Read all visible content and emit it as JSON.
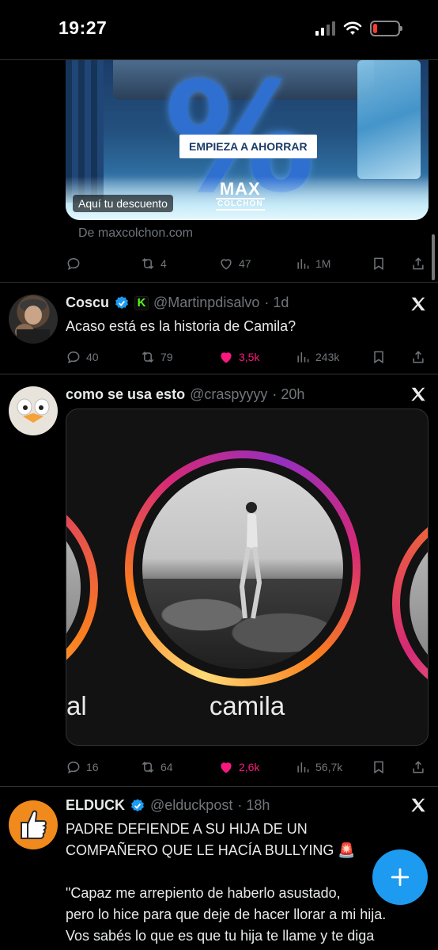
{
  "status": {
    "time": "19:27",
    "battery_level": 0.18
  },
  "ad": {
    "cta_label": "EMPIEZA A AHORRAR",
    "badge": "Aquí tu descuento",
    "logo_main": "MAX",
    "logo_sub": "COLCHON",
    "percent_symbol": "%",
    "source": "De maxcolchon.com",
    "actions": {
      "reposts": "4",
      "likes": "47",
      "views": "1M"
    }
  },
  "tweets": [
    {
      "name": "Coscu",
      "handle": "@Martinpdisalvo",
      "time": "· 1d",
      "badge_letter": "K",
      "text": "Acaso está es la historia de Camila?",
      "actions": {
        "replies": "40",
        "reposts": "79",
        "likes": "3,5k",
        "views": "243k"
      }
    },
    {
      "name": "como se usa esto",
      "handle": "@craspyyyy",
      "time": "· 20h",
      "story_label": "camila",
      "story_left_label": "al",
      "actions": {
        "replies": "16",
        "reposts": "64",
        "likes": "2,6k",
        "views": "56,7k"
      }
    },
    {
      "name": "ELDUCK",
      "handle": "@elduckpost",
      "time": "· 18h",
      "text_line1": "PADRE DEFIENDE A SU HIJA DE UN",
      "text_line2": "COMPAÑERO QUE LE HACÍA BULLYING 🚨",
      "text_line3": "\"Capaz me arrepiento de haberlo asustado,",
      "text_line4": "pero lo hice para que deje de hacer llorar a mi hija.",
      "text_line5": "Vos sabés lo que es que tu hija te llame y te diga"
    }
  ],
  "colors": {
    "accent": "#1d9bf0",
    "like": "#f91880",
    "muted": "#71767b",
    "background": "#000000"
  },
  "icons": [
    "reply-icon",
    "repost-icon",
    "like-icon",
    "views-icon",
    "bookmark-icon",
    "share-icon",
    "x-logo-icon",
    "verified-icon",
    "compose-icon"
  ]
}
